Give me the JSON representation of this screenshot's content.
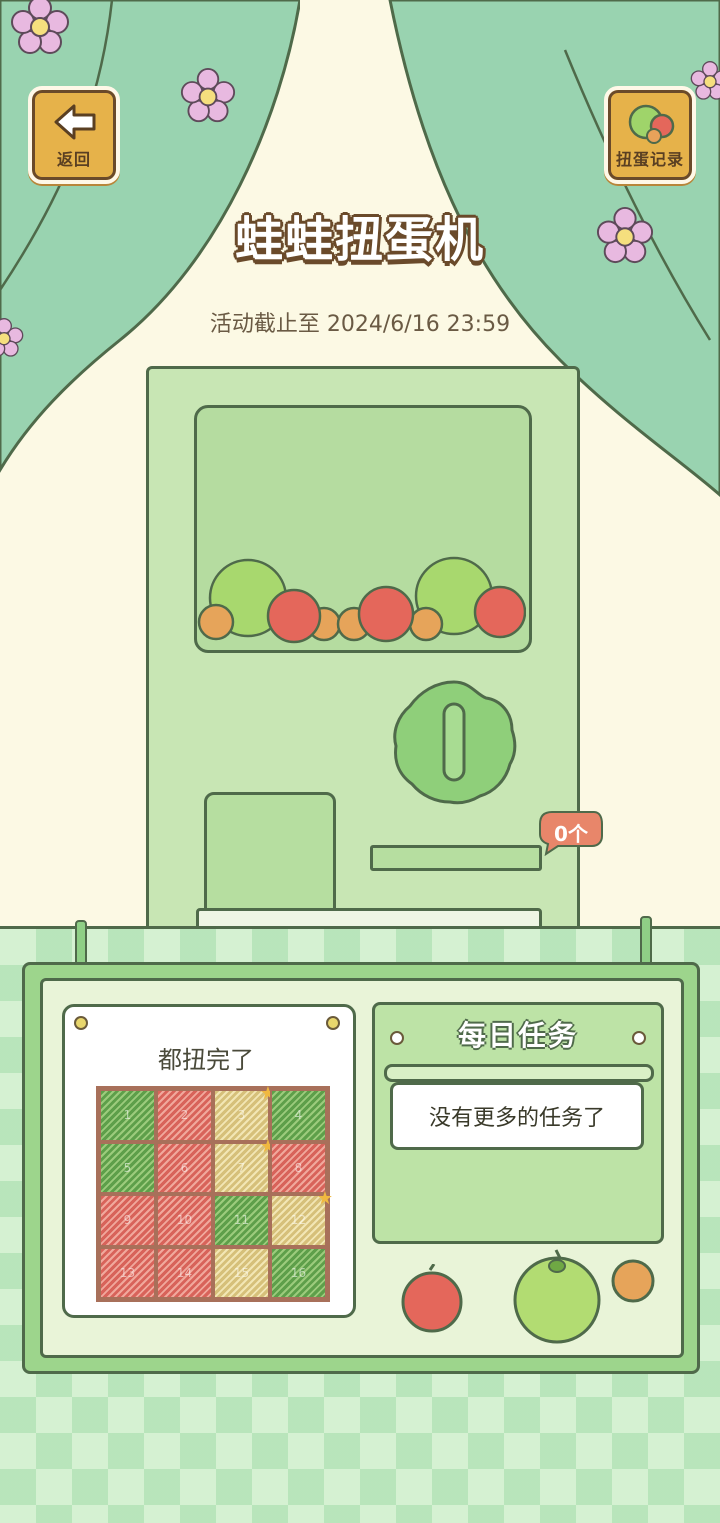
{
  "header": {
    "back_label": "返回",
    "record_label": "扭蛋记录",
    "title": "蛙蛙扭蛋机",
    "deadline": "活动截止至 2024/6/16 23:59"
  },
  "machine": {
    "count_bubble": "0个"
  },
  "collection_card": {
    "title": "都扭完了",
    "cells": [
      {
        "n": "1",
        "c": "g"
      },
      {
        "n": "2",
        "c": "r"
      },
      {
        "n": "3",
        "c": "y",
        "star": true
      },
      {
        "n": "4",
        "c": "g"
      },
      {
        "n": "5",
        "c": "g"
      },
      {
        "n": "6",
        "c": "r"
      },
      {
        "n": "7",
        "c": "y",
        "star": true
      },
      {
        "n": "8",
        "c": "r"
      },
      {
        "n": "9",
        "c": "r"
      },
      {
        "n": "10",
        "c": "r"
      },
      {
        "n": "11",
        "c": "g"
      },
      {
        "n": "12",
        "c": "y",
        "star": true
      },
      {
        "n": "13",
        "c": "r"
      },
      {
        "n": "14",
        "c": "r"
      },
      {
        "n": "15",
        "c": "y"
      },
      {
        "n": "16",
        "c": "g"
      }
    ]
  },
  "daily_tasks": {
    "title": "每日任务",
    "message": "没有更多的任务了"
  },
  "colors": {
    "curtain": "#99d3b0",
    "machine": "#c8e6b4",
    "outline": "#4f6a4a",
    "wood": "#e6b24a"
  }
}
